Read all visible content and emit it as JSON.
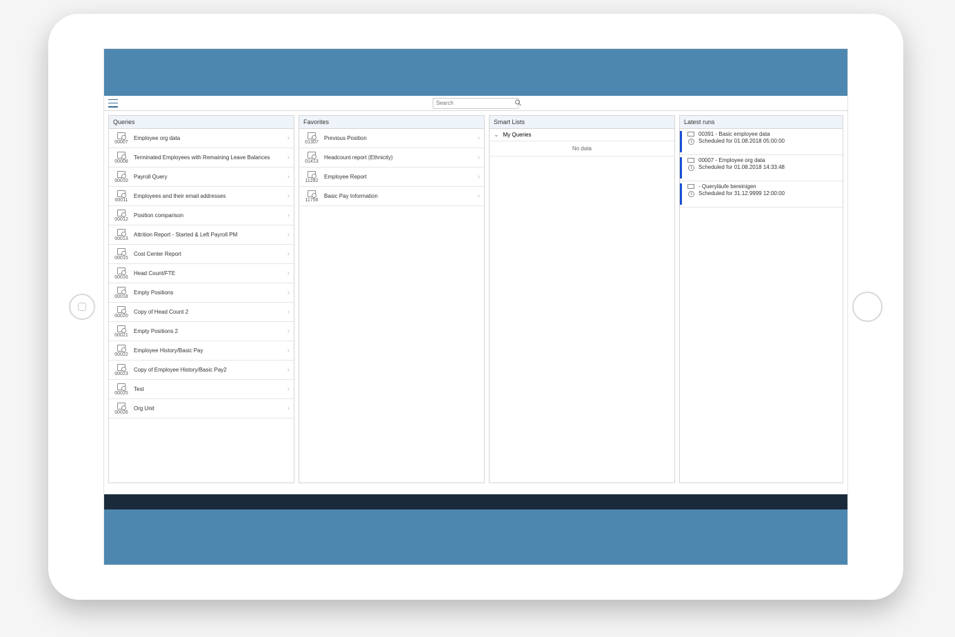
{
  "search": {
    "placeholder": "Search"
  },
  "panels": {
    "queries_title": "Queries",
    "favorites_title": "Favorites",
    "smart_title": "Smart Lists",
    "runs_title": "Latest runs"
  },
  "queries": [
    {
      "id": "00007",
      "label": "Employee org data"
    },
    {
      "id": "00008",
      "label": "Terminated Employees with Remaining Leave Balances"
    },
    {
      "id": "00010",
      "label": "Payroll Query"
    },
    {
      "id": "00011",
      "label": "Employees and their email addresses"
    },
    {
      "id": "00012",
      "label": "Position comparison"
    },
    {
      "id": "00013",
      "label": "Attrition Report - Started & Left Payroll PM"
    },
    {
      "id": "00015",
      "label": "Cost Center Report"
    },
    {
      "id": "00016",
      "label": "Head Count/FTE"
    },
    {
      "id": "00018",
      "label": "Empty Positions"
    },
    {
      "id": "00020",
      "label": "Copy of Head Count 2"
    },
    {
      "id": "00021",
      "label": "Empty Positions 2"
    },
    {
      "id": "00022",
      "label": "Employee History/Basic Pay"
    },
    {
      "id": "00023",
      "label": "Copy of Employee History/Basic Pay2"
    },
    {
      "id": "00025",
      "label": "Test"
    },
    {
      "id": "00026",
      "label": "Org Unit"
    }
  ],
  "favorites": [
    {
      "id": "01307",
      "label": "Previous Position"
    },
    {
      "id": "01413",
      "label": "Headcount report (Ethnicity)"
    },
    {
      "id": "11282",
      "label": "Employee Report"
    },
    {
      "id": "11756",
      "label": "Basic Pay Information"
    }
  ],
  "smart_lists": {
    "group_label": "My Queries",
    "no_data": "No data"
  },
  "latest_runs": [
    {
      "title": "00391 - Basic employee data",
      "sched": "Scheduled for 01.08.2018 05:00:00"
    },
    {
      "title": "00007 - Employee org data",
      "sched": "Scheduled for 01.08.2018 14:33:48"
    },
    {
      "title": "- Queryläufe bereinigen",
      "sched": "Scheduled for 31.12.9999 12:00:00"
    }
  ]
}
